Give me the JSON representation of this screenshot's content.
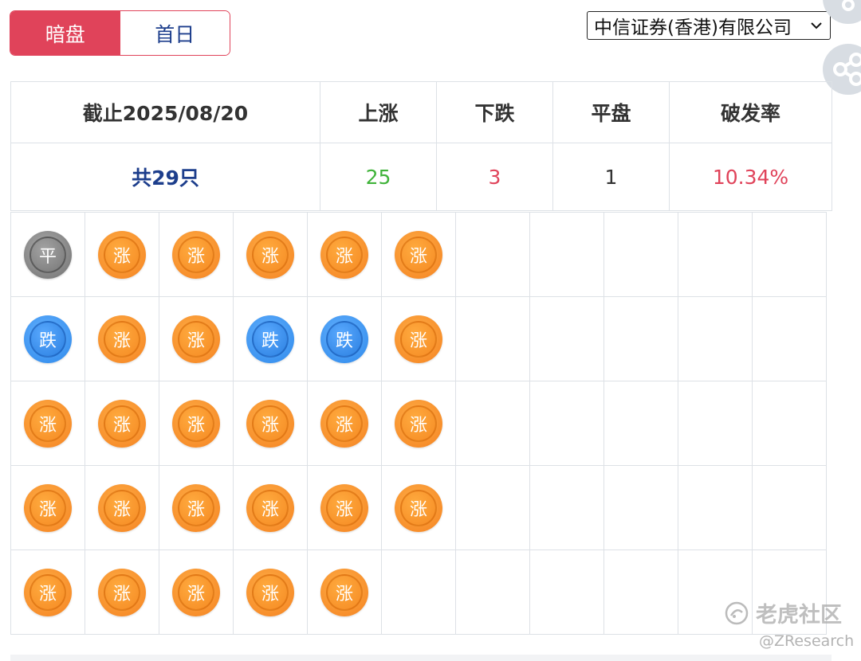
{
  "tabs": [
    {
      "label": "暗盘",
      "active": true
    },
    {
      "label": "首日",
      "active": false
    }
  ],
  "broker": {
    "selected": "中信证券(香港)有限公司"
  },
  "summary": {
    "headers": [
      "截止2025/08/20",
      "上涨",
      "下跌",
      "平盘",
      "破发率"
    ],
    "total": "共29只",
    "up": "25",
    "down": "3",
    "flat": "1",
    "break_rate": "10.34%"
  },
  "grid": {
    "rows": [
      [
        "平",
        "涨",
        "涨",
        "涨",
        "涨",
        "涨"
      ],
      [
        "跌",
        "涨",
        "涨",
        "跌",
        "跌",
        "涨"
      ],
      [
        "涨",
        "涨",
        "涨",
        "涨",
        "涨",
        "涨"
      ],
      [
        "涨",
        "涨",
        "涨",
        "涨",
        "涨",
        "涨"
      ],
      [
        "涨",
        "涨",
        "涨",
        "涨",
        "涨"
      ]
    ],
    "columns": 11
  },
  "watermark": {
    "brand": "老虎社区",
    "handle": "@ZResearch"
  },
  "colors": {
    "accent": "#e0435a",
    "up": "#40b33a",
    "down": "#e0435a",
    "navy": "#1d3e8c"
  }
}
